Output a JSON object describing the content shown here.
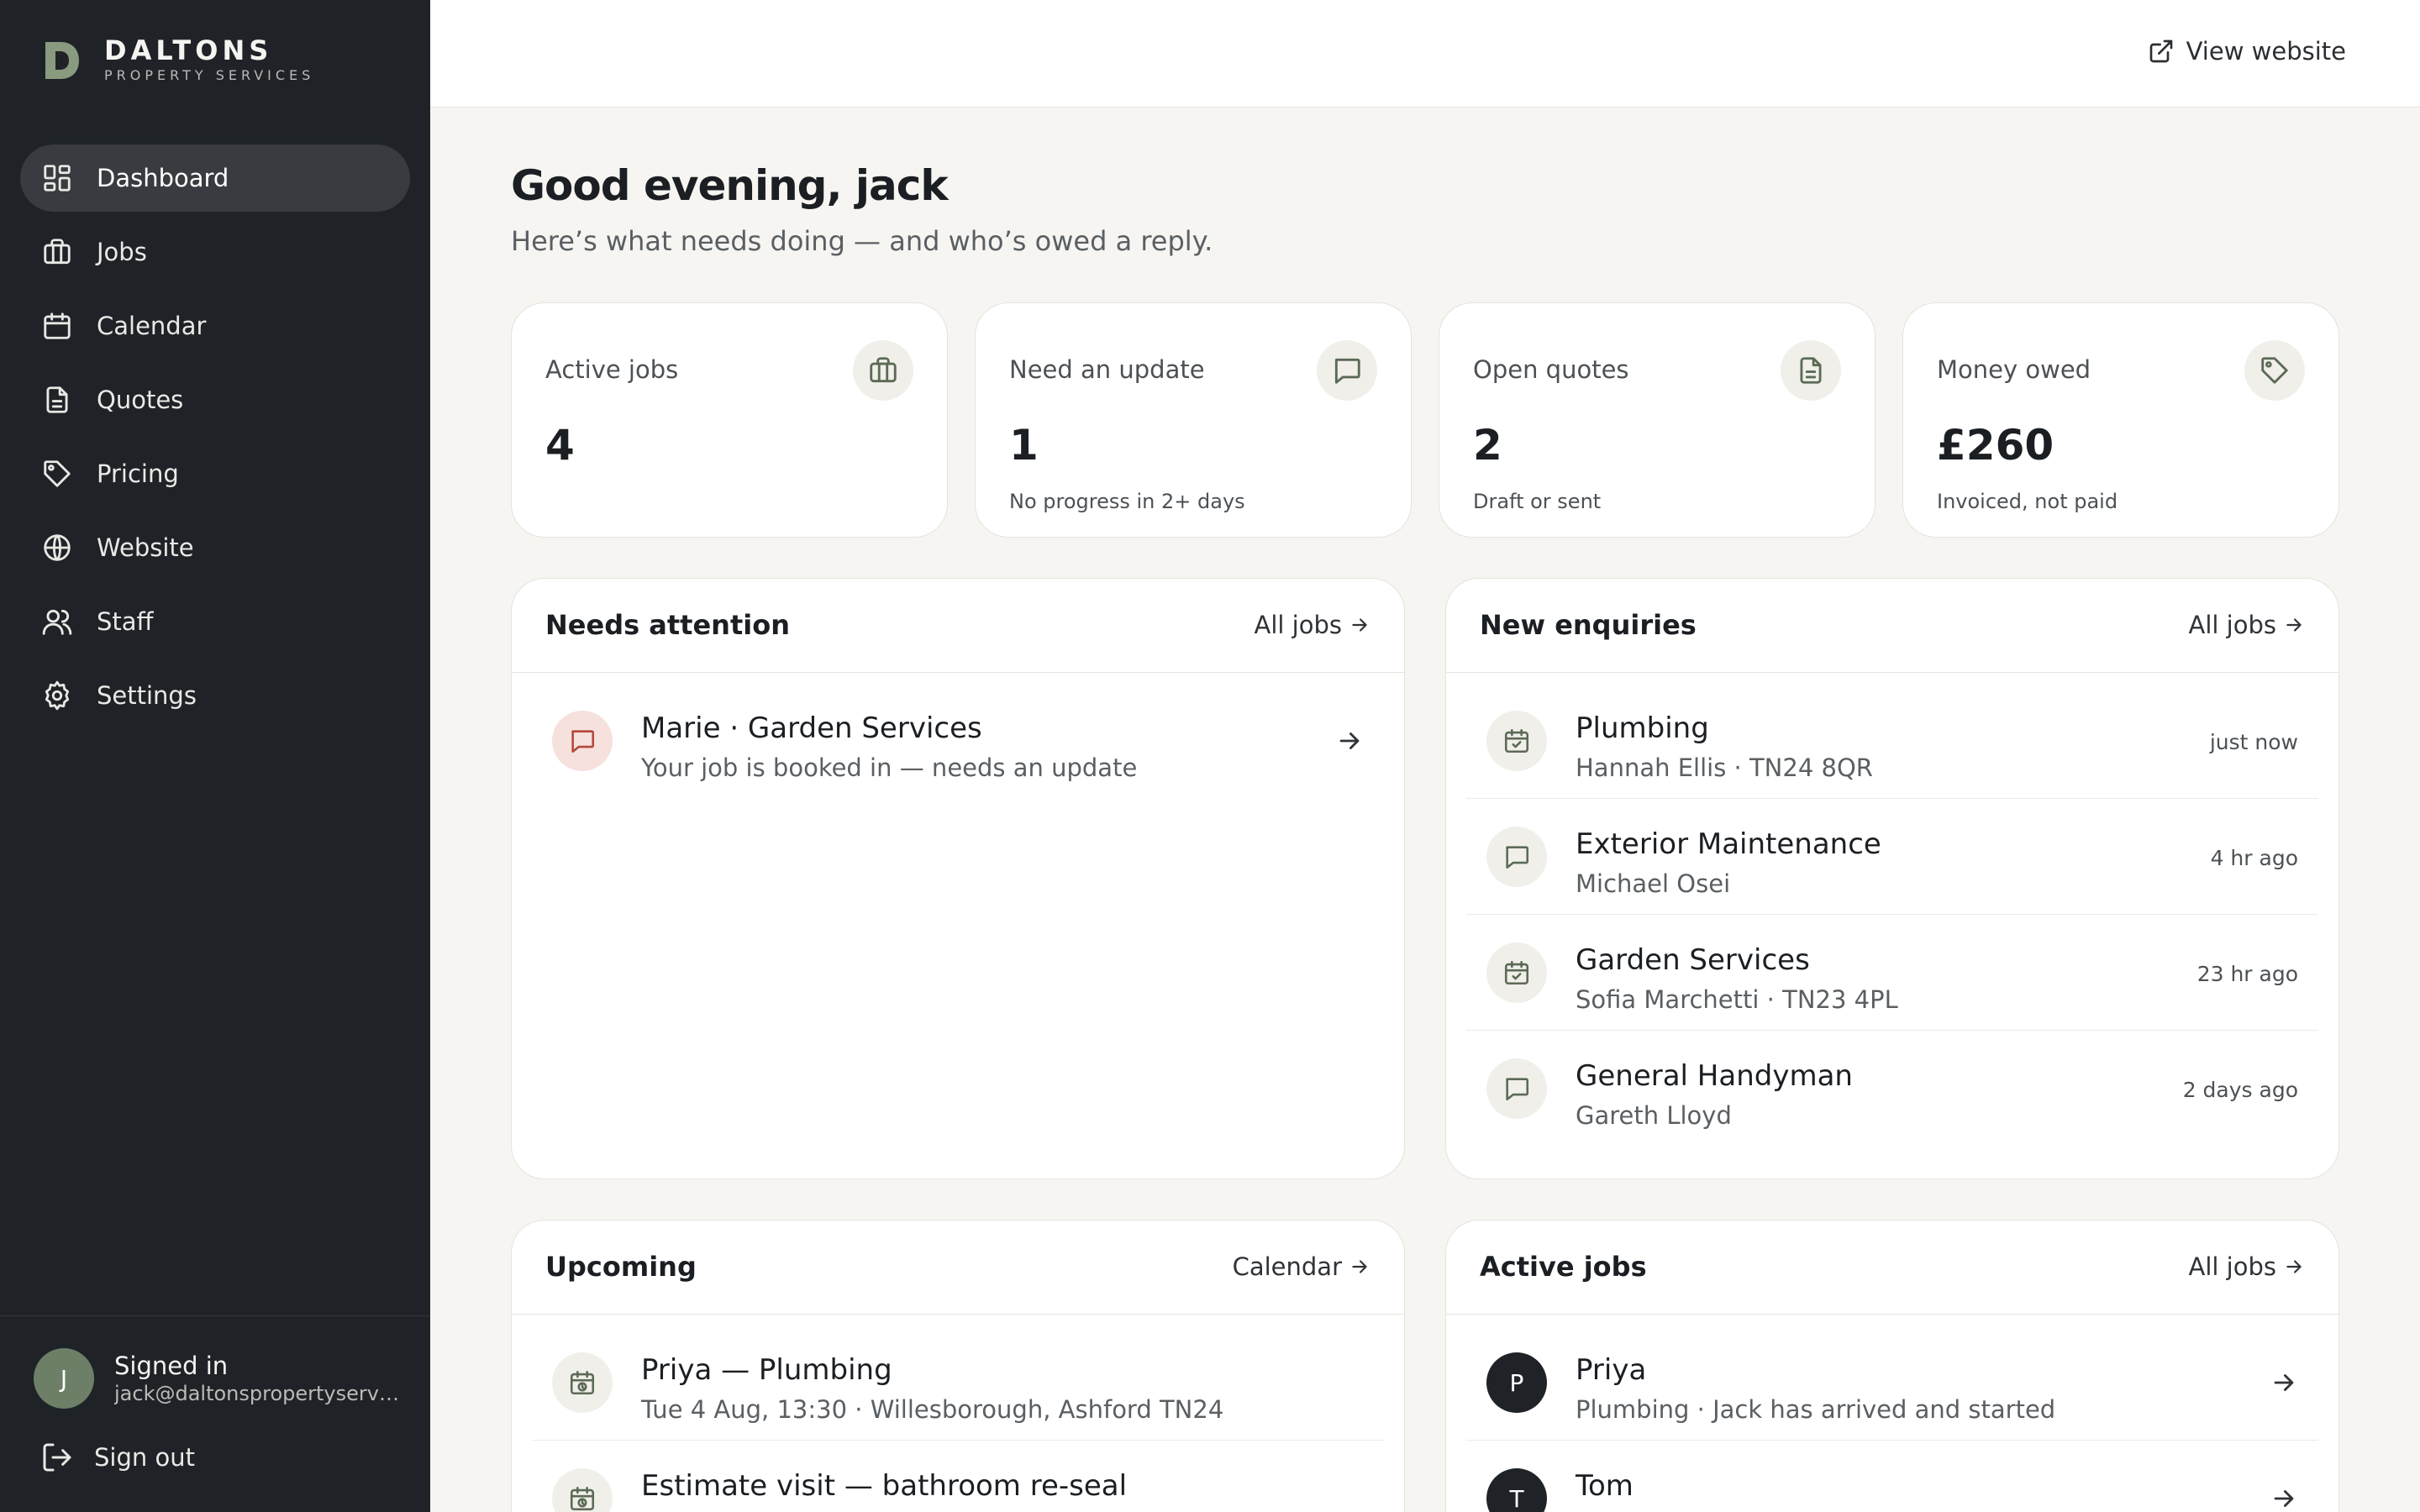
{
  "brand": {
    "name": "DALTONS",
    "sub": "PROPERTY SERVICES",
    "mark_color": "#8a9a7e"
  },
  "sidebar": {
    "items": [
      {
        "label": "Dashboard",
        "icon": "dashboard-icon",
        "active": true
      },
      {
        "label": "Jobs",
        "icon": "briefcase-icon"
      },
      {
        "label": "Calendar",
        "icon": "calendar-icon"
      },
      {
        "label": "Quotes",
        "icon": "document-icon"
      },
      {
        "label": "Pricing",
        "icon": "tag-icon"
      },
      {
        "label": "Website",
        "icon": "globe-icon"
      },
      {
        "label": "Staff",
        "icon": "users-icon"
      },
      {
        "label": "Settings",
        "icon": "gear-icon"
      }
    ],
    "user": {
      "initial": "J",
      "status": "Signed in",
      "email": "jack@daltonspropertyservic..."
    },
    "signout": "Sign out"
  },
  "topbar": {
    "view_website": "View website"
  },
  "main": {
    "greeting": "Good evening, jack",
    "subgreeting": "Here’s what needs doing — and who’s owed a reply.",
    "stats": [
      {
        "label": "Active jobs",
        "value": "4",
        "note": "",
        "icon": "briefcase-icon"
      },
      {
        "label": "Need an update",
        "value": "1",
        "note": "No progress in 2+ days",
        "icon": "message-icon"
      },
      {
        "label": "Open quotes",
        "value": "2",
        "note": "Draft or sent",
        "icon": "document-icon"
      },
      {
        "label": "Money owed",
        "value": "£260",
        "note": "Invoiced, not paid",
        "icon": "tag-icon"
      }
    ],
    "attention": {
      "title": "Needs attention",
      "link": "All jobs",
      "items": [
        {
          "title": "Marie · Garden Services",
          "sub": "Your job is booked in — needs an update"
        }
      ]
    },
    "enquiries": {
      "title": "New enquiries",
      "link": "All jobs",
      "items": [
        {
          "title": "Plumbing",
          "sub": "Hannah Ellis · TN24 8QR",
          "time": "just now",
          "icon": "calendar-check-icon"
        },
        {
          "title": "Exterior Maintenance",
          "sub": "Michael Osei",
          "time": "4 hr ago",
          "icon": "message-icon"
        },
        {
          "title": "Garden Services",
          "sub": "Sofia Marchetti · TN23 4PL",
          "time": "23 hr ago",
          "icon": "calendar-check-icon"
        },
        {
          "title": "General Handyman",
          "sub": "Gareth Lloyd",
          "time": "2 days ago",
          "icon": "message-icon"
        }
      ]
    },
    "upcoming": {
      "title": "Upcoming",
      "link": "Calendar",
      "items": [
        {
          "title": "Priya — Plumbing",
          "sub": "Tue 4 Aug, 13:30 · Willesborough, Ashford TN24"
        },
        {
          "title": "Estimate visit — bathroom re-seal",
          "sub": ""
        }
      ]
    },
    "active_jobs": {
      "title": "Active jobs",
      "link": "All jobs",
      "items": [
        {
          "initial": "P",
          "title": "Priya",
          "sub": "Plumbing · Jack has arrived and started"
        },
        {
          "initial": "T",
          "title": "Tom",
          "sub": ""
        }
      ]
    }
  }
}
